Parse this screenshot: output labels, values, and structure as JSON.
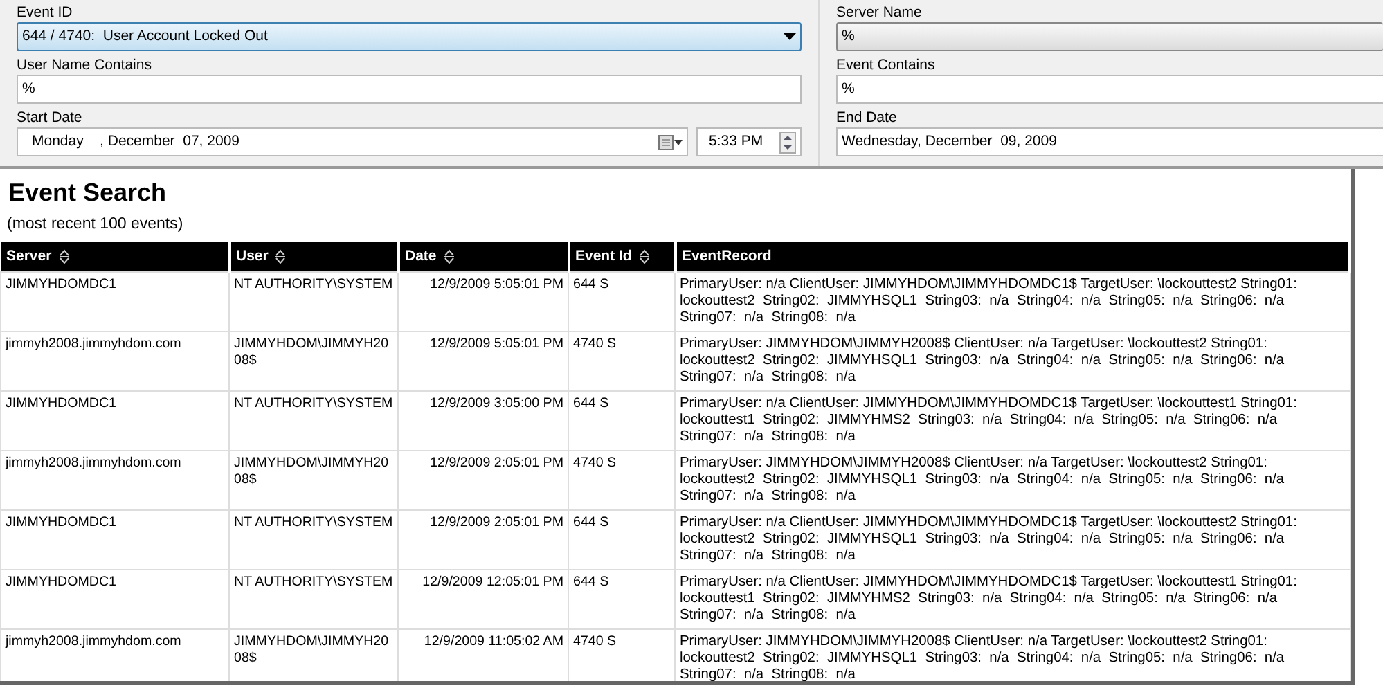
{
  "filters": {
    "left": [
      {
        "label": "Event ID",
        "kind": "dropdown",
        "value": "644 / 4740:  User Account Locked Out",
        "focused": true
      },
      {
        "label": "User Name Contains",
        "kind": "text",
        "value": "%"
      },
      {
        "label": "Start Date",
        "kind": "datetime",
        "value": "Monday    , December  07, 2009",
        "time": "5:33 PM"
      }
    ],
    "right": [
      {
        "label": "Server Name",
        "kind": "dropdown",
        "value": "%",
        "focused": false
      },
      {
        "label": "Event Contains",
        "kind": "text",
        "value": "%"
      },
      {
        "label": "End Date",
        "kind": "text",
        "value": "Wednesday, December  09, 2009"
      }
    ]
  },
  "results": {
    "title": "Event Search",
    "subtitle": "(most recent 100 events)",
    "columns": [
      {
        "label": "Server",
        "sortable": true
      },
      {
        "label": "User",
        "sortable": true
      },
      {
        "label": "Date",
        "sortable": true
      },
      {
        "label": "Event Id",
        "sortable": true
      },
      {
        "label": "EventRecord",
        "sortable": false
      }
    ],
    "rows": [
      [
        "JIMMYHDOMDC1",
        "NT AUTHORITY\\SYSTEM",
        "12/9/2009 5:05:01 PM",
        "644 S",
        "PrimaryUser: n/a ClientUser: JIMMYHDOM\\JIMMYHDOMDC1$ TargetUser: \\lockouttest2 String01: lockouttest2  String02:  JIMMYHSQL1  String03:  n/a  String04:  n/a  String05:  n/a  String06:  n/a  String07:  n/a  String08:  n/a"
      ],
      [
        "jimmyh2008.jimmyhdom.com",
        "JIMMYHDOM\\JIMMYH2008$",
        "12/9/2009 5:05:01 PM",
        "4740 S",
        "PrimaryUser: JIMMYHDOM\\JIMMYH2008$ ClientUser: n/a TargetUser: \\lockouttest2 String01: lockouttest2  String02:  JIMMYHSQL1  String03:  n/a  String04:  n/a  String05:  n/a  String06:  n/a  String07:  n/a  String08:  n/a"
      ],
      [
        "JIMMYHDOMDC1",
        "NT AUTHORITY\\SYSTEM",
        "12/9/2009 3:05:00 PM",
        "644 S",
        "PrimaryUser: n/a ClientUser: JIMMYHDOM\\JIMMYHDOMDC1$ TargetUser: \\lockouttest1 String01: lockouttest1  String02:  JIMMYHMS2  String03:  n/a  String04:  n/a  String05:  n/a  String06:  n/a  String07:  n/a  String08:  n/a"
      ],
      [
        "jimmyh2008.jimmyhdom.com",
        "JIMMYHDOM\\JIMMYH2008$",
        "12/9/2009 2:05:01 PM",
        "4740 S",
        "PrimaryUser: JIMMYHDOM\\JIMMYH2008$ ClientUser: n/a TargetUser: \\lockouttest2 String01: lockouttest2  String02:  JIMMYHSQL1  String03:  n/a  String04:  n/a  String05:  n/a  String06:  n/a  String07:  n/a  String08:  n/a"
      ],
      [
        "JIMMYHDOMDC1",
        "NT AUTHORITY\\SYSTEM",
        "12/9/2009 2:05:01 PM",
        "644 S",
        "PrimaryUser: n/a ClientUser: JIMMYHDOM\\JIMMYHDOMDC1$ TargetUser: \\lockouttest2 String01: lockouttest2  String02:  JIMMYHSQL1  String03:  n/a  String04:  n/a  String05:  n/a  String06:  n/a  String07:  n/a  String08:  n/a"
      ],
      [
        "JIMMYHDOMDC1",
        "NT AUTHORITY\\SYSTEM",
        "12/9/2009 12:05:01 PM",
        "644 S",
        "PrimaryUser: n/a ClientUser: JIMMYHDOM\\JIMMYHDOMDC1$ TargetUser: \\lockouttest1 String01: lockouttest1  String02:  JIMMYHMS2  String03:  n/a  String04:  n/a  String05:  n/a  String06:  n/a  String07:  n/a  String08:  n/a"
      ],
      [
        "jimmyh2008.jimmyhdom.com",
        "JIMMYHDOM\\JIMMYH2008$",
        "12/9/2009 11:05:02 AM",
        "4740 S",
        "PrimaryUser: JIMMYHDOM\\JIMMYH2008$ ClientUser: n/a TargetUser: \\lockouttest2 String01: lockouttest2  String02:  JIMMYHSQL1  String03:  n/a  String04:  n/a  String05:  n/a  String06:  n/a  String07:  n/a  String08:  n/a"
      ]
    ]
  }
}
